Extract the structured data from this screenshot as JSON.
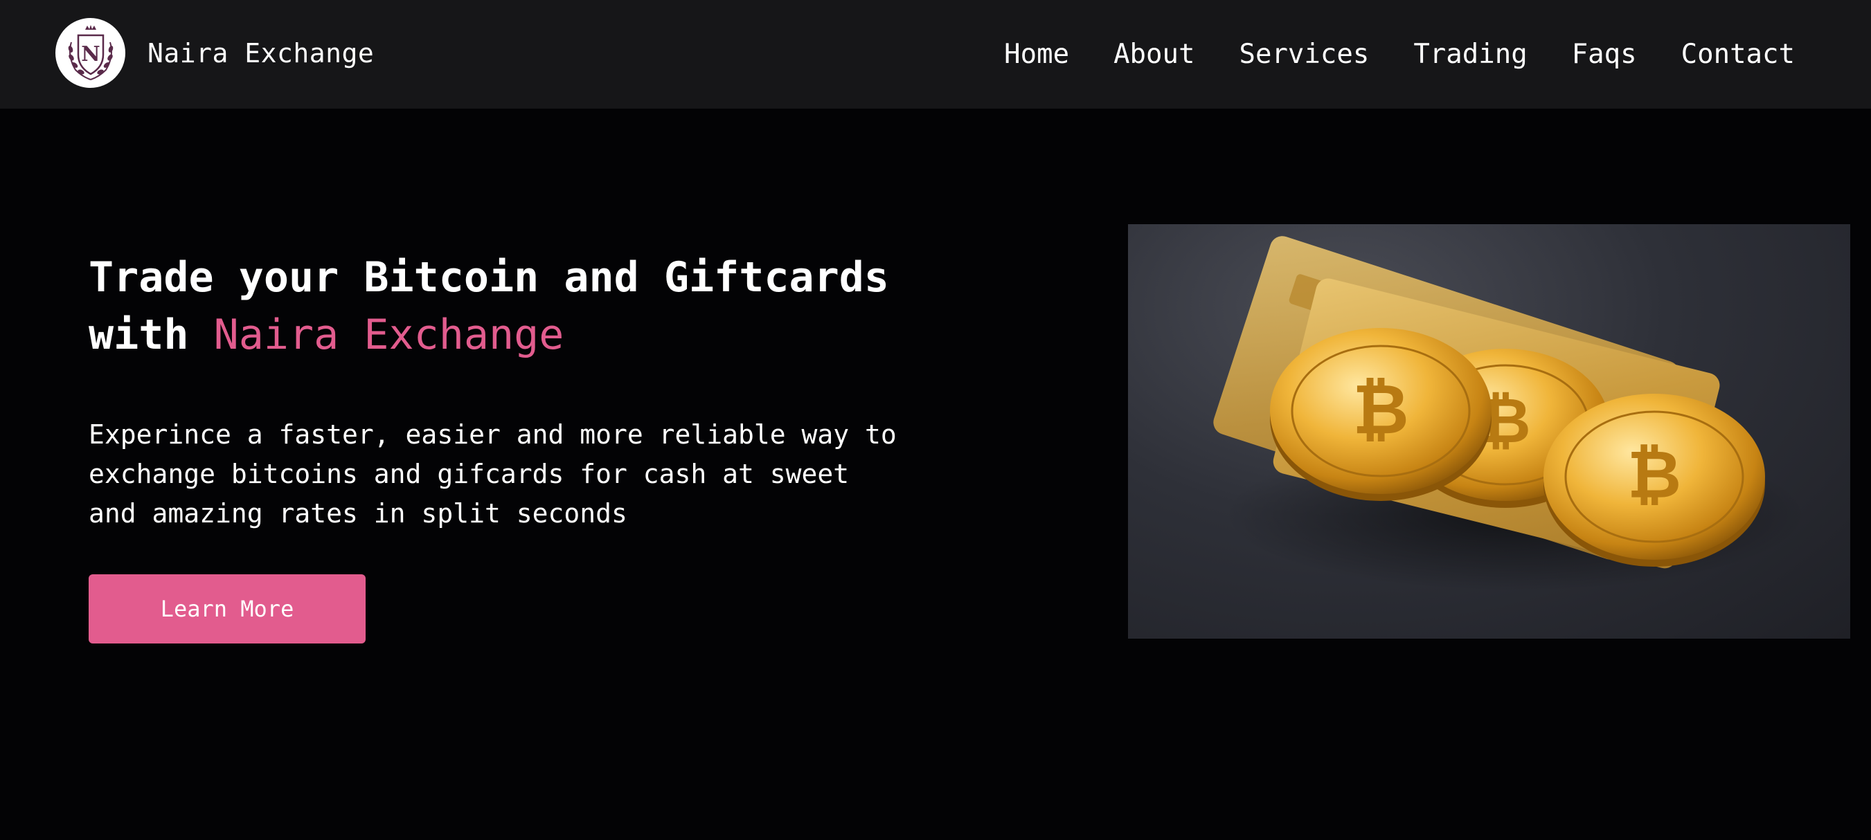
{
  "brand": {
    "name": "Naira Exchange",
    "logo_letter": "N",
    "logo_icon": "crest-logo-icon"
  },
  "nav": {
    "items": [
      {
        "label": "Home"
      },
      {
        "label": "About"
      },
      {
        "label": "Services"
      },
      {
        "label": "Trading"
      },
      {
        "label": "Faqs"
      },
      {
        "label": "Contact"
      }
    ]
  },
  "hero": {
    "title_line1": "Trade your Bitcoin and Giftcards",
    "title_line2_prefix": "with ",
    "title_accent": "Naira Exchange",
    "description": "Experince a faster, easier and more reliable way to exchange bitcoins and gifcards for cash at sweet and amazing rates in split seconds",
    "cta_label": "Learn More",
    "image_icon": "bitcoin-coins-image"
  },
  "colors": {
    "accent": "#e25c8e",
    "navbar_bg": "#161618",
    "page_bg": "#030305",
    "text": "#ffffff"
  }
}
